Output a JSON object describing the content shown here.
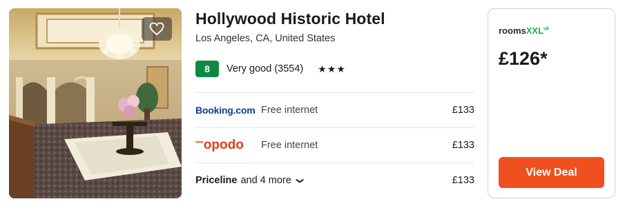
{
  "hotel": {
    "name": "Hollywood Historic Hotel",
    "location": "Los Angeles, CA, United States",
    "score": "8",
    "rating_text": "Very good (3554)",
    "stars": "★★★"
  },
  "deals": [
    {
      "provider": "Booking.com",
      "feature": "Free internet",
      "price": "£133"
    },
    {
      "provider": "opodo",
      "feature": "Free internet",
      "price": "£133"
    },
    {
      "provider": "Priceline",
      "more": "and 4 more",
      "price": "£133"
    }
  ],
  "featured": {
    "provider": "roomsXXL",
    "provider_parts": {
      "rooms": "rooms",
      "xxl": "XXL",
      "uk": "uk"
    },
    "price": "£126*",
    "button": "View Deal"
  },
  "colors": {
    "score_bg": "#0c8a3f",
    "cta": "#f0501f",
    "booking_blue": "#0f3c8c",
    "opodo_red": "#e53a1c",
    "rooms_green": "#19b24b"
  },
  "icons": {
    "favorite": "heart-outline-icon",
    "expand": "chevron-down-icon"
  }
}
